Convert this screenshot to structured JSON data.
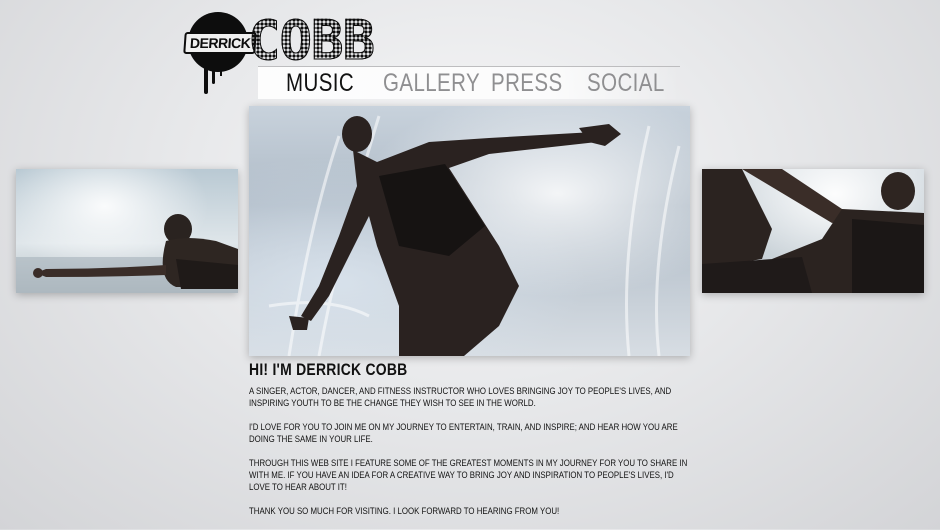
{
  "logo": {
    "first_name": "DERRICK",
    "last_name": "COBB"
  },
  "nav": {
    "items": [
      {
        "label": "MUSIC",
        "active": true
      },
      {
        "label": "GALLERY",
        "active": false
      },
      {
        "label": "PRESS",
        "active": false
      },
      {
        "label": "SOCIAL",
        "active": false
      }
    ]
  },
  "photos": {
    "left": "photo of man lying on wet ground",
    "center": "photo of man dancing in water spray",
    "right": "photo of man reclining in water"
  },
  "intro": {
    "headline": "HI! I'M DERRICK COBB",
    "paragraphs": [
      "A SINGER, ACTOR, DANCER, AND FITNESS INSTRUCTOR WHO LOVES BRINGING JOY TO PEOPLE'S LIVES, AND INSPIRING YOUTH TO BE THE CHANGE THEY WISH TO SEE IN THE WORLD.",
      "I'D LOVE FOR YOU TO JOIN ME ON MY JOURNEY TO ENTERTAIN, TRAIN, AND INSPIRE; AND HEAR HOW YOU ARE DOING THE SAME IN YOUR LIFE.",
      "THROUGH THIS WEB SITE I FEATURE SOME OF THE GREATEST MOMENTS IN MY JOURNEY FOR YOU TO SHARE IN WITH ME. IF YOU HAVE AN IDEA FOR A CREATIVE WAY TO BRING JOY AND INSPIRATION TO PEOPLE'S LIVES, I'D LOVE TO HEAR ABOUT IT!",
      "THANK YOU SO MUCH FOR VISITING. I LOOK FORWARD TO HEARING FROM YOU!"
    ]
  },
  "colors": {
    "nav_active": "#111111",
    "nav_inactive": "#8f8f91",
    "background": "#e7e8ea"
  }
}
